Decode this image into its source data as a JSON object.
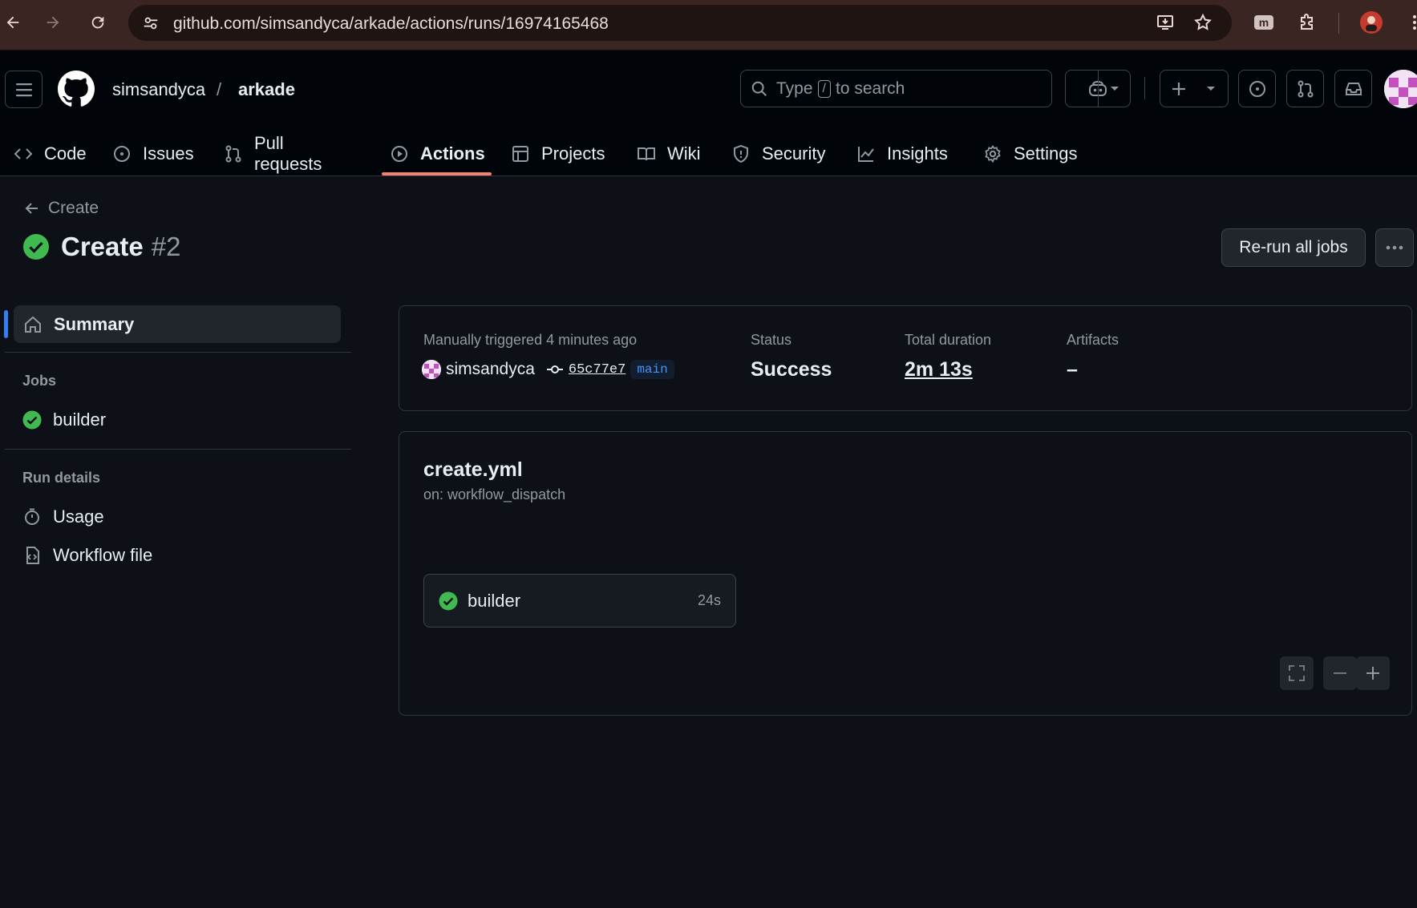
{
  "browser": {
    "url": "github.com/simsandyca/arkade/actions/runs/16974165468"
  },
  "header": {
    "owner": "simsandyca",
    "separator": "/",
    "repo": "arkade",
    "search_prefix": "Type",
    "search_key": "/",
    "search_suffix": "to search"
  },
  "tabs": [
    {
      "label": "Code",
      "icon": "code-icon"
    },
    {
      "label": "Issues",
      "icon": "issue-icon"
    },
    {
      "label": "Pull requests",
      "icon": "pull-request-icon"
    },
    {
      "label": "Actions",
      "icon": "play-icon",
      "active": true
    },
    {
      "label": "Projects",
      "icon": "table-icon"
    },
    {
      "label": "Wiki",
      "icon": "book-icon"
    },
    {
      "label": "Security",
      "icon": "shield-icon"
    },
    {
      "label": "Insights",
      "icon": "graph-icon"
    },
    {
      "label": "Settings",
      "icon": "gear-icon"
    }
  ],
  "run": {
    "back_label": "Create",
    "title": "Create",
    "number": "#2",
    "rerun_label": "Re-run all jobs"
  },
  "sidebar": {
    "summary_label": "Summary",
    "jobs_heading": "Jobs",
    "jobs": [
      {
        "label": "builder",
        "status": "success"
      }
    ],
    "details_heading": "Run details",
    "usage_label": "Usage",
    "workflow_file_label": "Workflow file"
  },
  "summary": {
    "trigger_text": "Manually triggered 4 minutes ago",
    "actor": "simsandyca",
    "commit": "65c77e7",
    "branch": "main",
    "status_label": "Status",
    "status_value": "Success",
    "duration_label": "Total duration",
    "duration_value": "2m 13s",
    "artifacts_label": "Artifacts",
    "artifacts_value": "–"
  },
  "workflow": {
    "file": "create.yml",
    "trigger": "on: workflow_dispatch",
    "job_name": "builder",
    "job_duration": "24s"
  },
  "colors": {
    "success": "#3fb950",
    "accent_underline": "#f78166",
    "link_blue": "#4493f8"
  }
}
